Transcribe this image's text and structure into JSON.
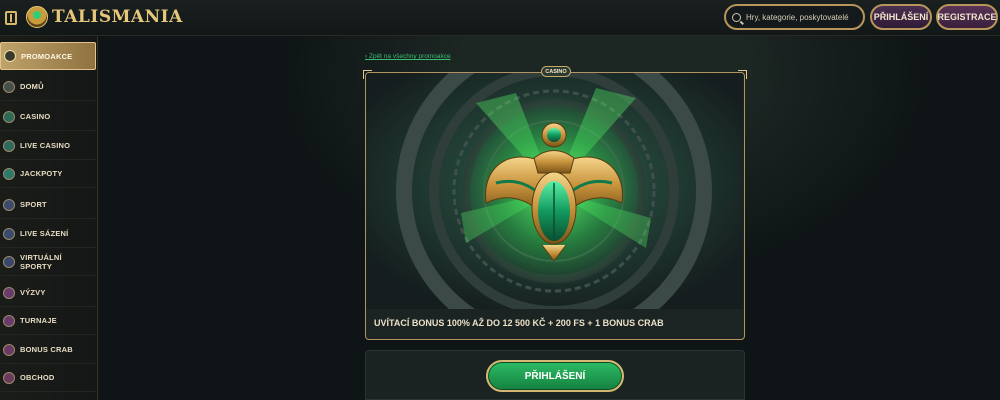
{
  "header": {
    "logo_text": "TALISMANIA",
    "search_placeholder": "Hry, kategorie, poskytovatelé",
    "login_label": "PŘIHLÁŠENÍ",
    "register_label": "REGISTRACE"
  },
  "sidebar": {
    "items": [
      {
        "label": "PROMOAKCE",
        "icon": "promo-icon",
        "active": true
      },
      {
        "label": "DOMŮ",
        "icon": "home-icon"
      },
      {
        "label": "CASINO",
        "icon": "casino-icon"
      },
      {
        "label": "LIVE CASINO",
        "icon": "live-casino-icon"
      },
      {
        "label": "JACKPOTY",
        "icon": "jackpot-icon"
      },
      {
        "label": "SPORT",
        "icon": "sport-icon"
      },
      {
        "label": "LIVE SÁZENÍ",
        "icon": "live-betting-icon"
      },
      {
        "label": "VIRTUÁLNÍ SPORTY",
        "icon": "virtual-sports-icon"
      },
      {
        "label": "VÝZVY",
        "icon": "challenges-icon"
      },
      {
        "label": "TURNAJE",
        "icon": "tournaments-icon"
      },
      {
        "label": "BONUS CRAB",
        "icon": "bonus-crab-icon"
      },
      {
        "label": "OBCHOD",
        "icon": "shop-icon"
      }
    ]
  },
  "main": {
    "back_link": "Zpět na všechny promoakce",
    "promo": {
      "badge": "CASINO",
      "title": "UVÍTACÍ BONUS 100% AŽ DO 12 500 KČ + 200 FS + 1 BONUS CRAB",
      "art_icon": "scarab-icon"
    },
    "login_button": "PŘIHLÁŠENÍ"
  },
  "colors": {
    "gold": "#c8a45e",
    "green_accent": "#2dbb65",
    "background": "#0f1516"
  }
}
